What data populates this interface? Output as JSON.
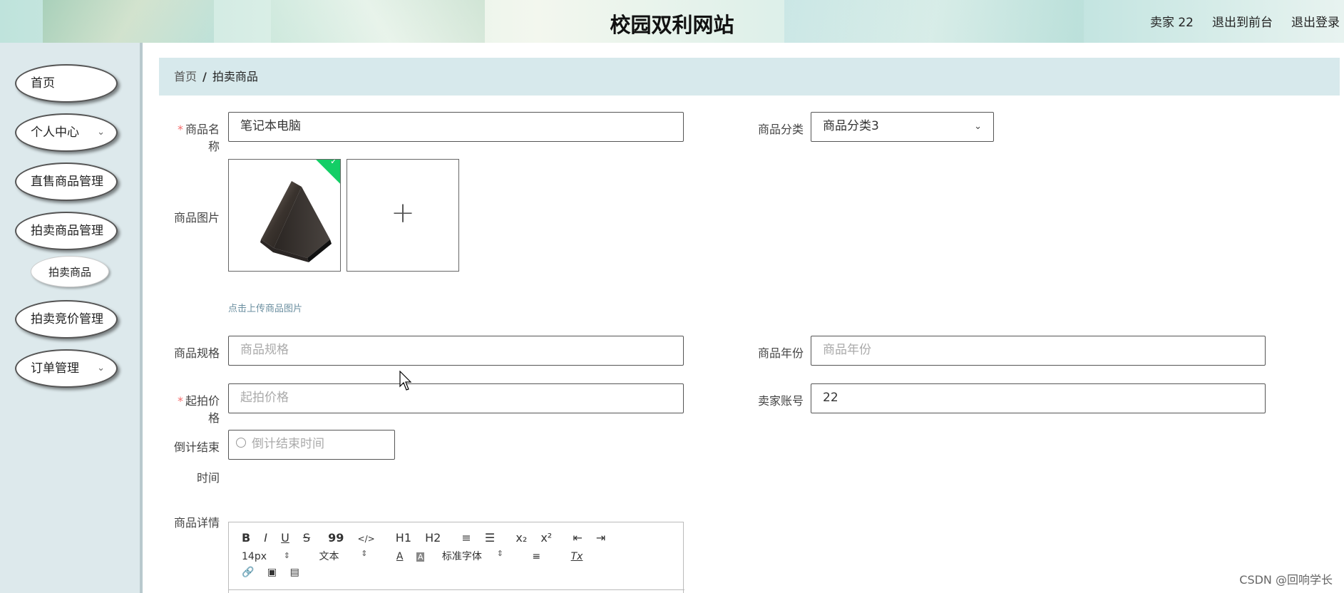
{
  "header": {
    "title": "校园双利网站",
    "links": [
      "卖家 22",
      "退出到前台",
      "退出登录"
    ]
  },
  "sidebar": {
    "items": [
      {
        "label": "首页"
      },
      {
        "label": "个人中心"
      },
      {
        "label": "直售商品管理"
      },
      {
        "label": "拍卖商品管理"
      },
      {
        "label": "拍卖商品"
      },
      {
        "label": "拍卖竞价管理"
      },
      {
        "label": "订单管理"
      }
    ]
  },
  "breadcrumb": {
    "home": "首页",
    "separator": "/",
    "current": "拍卖商品"
  },
  "form": {
    "name_label": "商品名称",
    "name_value": "笔记本电脑",
    "category_label": "商品分类",
    "category_value": "商品分类3",
    "image_label": "商品图片",
    "upload_hint": "点击上传商品图片",
    "spec_label": "商品规格",
    "spec_placeholder": "商品规格",
    "year_label": "商品年份",
    "year_placeholder": "商品年份",
    "price_label": "起拍价格",
    "price_placeholder": "起拍价格",
    "seller_label": "卖家账号",
    "seller_value": "22",
    "countdown_label_line1": "倒计结束",
    "countdown_label_line2": "时间",
    "countdown_placeholder": "倒计结束时间",
    "detail_label": "商品详情"
  },
  "editor": {
    "row1": [
      "B",
      "I",
      "U",
      "S",
      "99",
      "</>",
      "H1",
      "H2",
      "≡",
      "☰",
      "x₂",
      "x²",
      "⇤",
      "⇥"
    ],
    "font_size": "14px",
    "paragraph": "文本",
    "font_family": "标准字体",
    "align_icon": "≡",
    "clear_icon": "Tx"
  },
  "watermark": "CSDN @回响学长"
}
